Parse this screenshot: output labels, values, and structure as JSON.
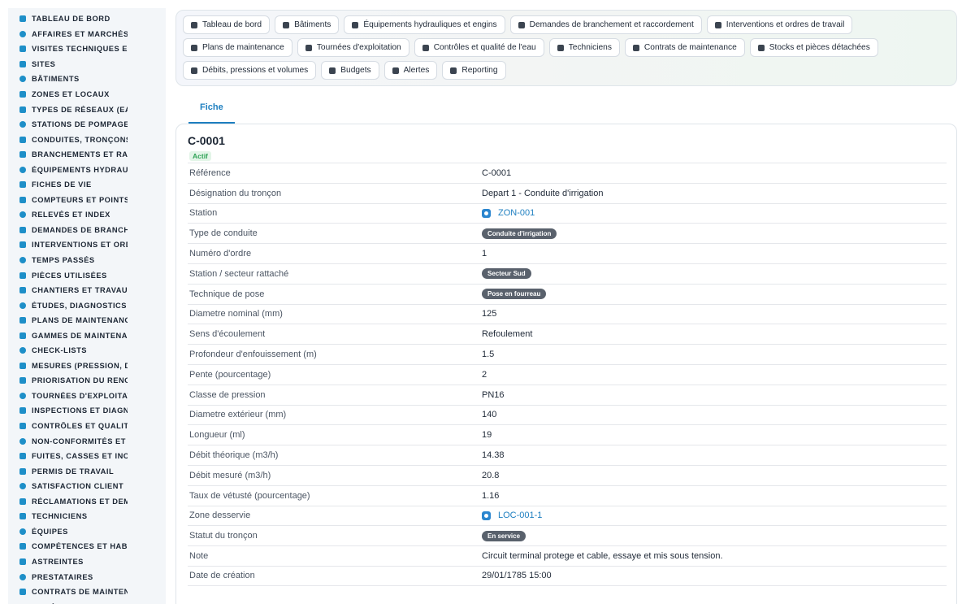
{
  "sidebar": {
    "items": [
      {
        "label": "TABLEAU DE BORD",
        "icon": "dashboard-icon"
      },
      {
        "label": "AFFAIRES ET MARCHÉS",
        "icon": "target-icon"
      },
      {
        "label": "VISITES TECHNIQUES ET",
        "icon": "clipboard-icon"
      },
      {
        "label": "SITES",
        "icon": "map-pin-icon"
      },
      {
        "label": "BÂTIMENTS",
        "icon": "building-icon"
      },
      {
        "label": "ZONES ET LOCAUX",
        "icon": "rooms-icon"
      },
      {
        "label": "TYPES DE RÉSEAUX (EAU",
        "icon": "network-icon"
      },
      {
        "label": "STATIONS DE POMPAGE I",
        "icon": "grid-icon"
      },
      {
        "label": "CONDUITES, TRONÇONS",
        "icon": "pipe-icon"
      },
      {
        "label": "BRANCHEMENTS ET RAC",
        "icon": "connection-icon"
      },
      {
        "label": "ÉQUIPEMENTS HYDRAUL",
        "icon": "gears-icon"
      },
      {
        "label": "FICHES DE VIE",
        "icon": "history-icon"
      },
      {
        "label": "COMPTEURS ET POINTS I",
        "icon": "gauge-icon"
      },
      {
        "label": "RELEVÉS ET INDEX",
        "icon": "chart-icon"
      },
      {
        "label": "DEMANDES DE BRANCHE",
        "icon": "question-icon"
      },
      {
        "label": "INTERVENTIONS ET ORDI",
        "icon": "clipboard-check-icon"
      },
      {
        "label": "TEMPS PASSÉS",
        "icon": "clock-icon"
      },
      {
        "label": "PIÈCES UTILISÉES",
        "icon": "parts-icon"
      },
      {
        "label": "CHANTIERS ET TRAVAUX",
        "icon": "hammer-icon"
      },
      {
        "label": "ÉTUDES, DIAGNOSTICS E",
        "icon": "flask-icon"
      },
      {
        "label": "PLANS DE MAINTENANCE",
        "icon": "calendar-icon"
      },
      {
        "label": "GAMMES DE MAINTENAN",
        "icon": "list-icon"
      },
      {
        "label": "CHECK-LISTS",
        "icon": "checklist-icon"
      },
      {
        "label": "MESURES (PRESSION, DÉ",
        "icon": "thermometer-icon"
      },
      {
        "label": "PRIORISATION DU RENOU",
        "icon": "trend-icon"
      },
      {
        "label": "TOURNÉES D'EXPLOITATI",
        "icon": "route-icon"
      },
      {
        "label": "INSPECTIONS ET DIAGNC",
        "icon": "search-icon"
      },
      {
        "label": "CONTRÔLES ET QUALITÉ",
        "icon": "clipboard-icon"
      },
      {
        "label": "NON-CONFORMITÉS ET A",
        "icon": "alert-circle-icon"
      },
      {
        "label": "FUITES, CASSES ET INCI",
        "icon": "warning-icon"
      },
      {
        "label": "PERMIS DE TRAVAIL",
        "icon": "permit-icon"
      },
      {
        "label": "SATISFACTION CLIENT",
        "icon": "smile-icon"
      },
      {
        "label": "RÉCLAMATIONS ET DEMA",
        "icon": "comment-icon"
      },
      {
        "label": "TECHNICIENS",
        "icon": "helmet-icon"
      },
      {
        "label": "ÉQUIPES",
        "icon": "users-icon"
      },
      {
        "label": "COMPÉTENCES ET HABIL",
        "icon": "badge-icon"
      },
      {
        "label": "ASTREINTES",
        "icon": "phone-icon"
      },
      {
        "label": "PRESTATAIRES",
        "icon": "handshake-icon"
      },
      {
        "label": "CONTRATS DE MAINTENA",
        "icon": "file-icon"
      },
      {
        "label": "MODÈLES DE CONTRATS",
        "icon": "file-icon"
      }
    ]
  },
  "nav": {
    "rows": [
      [
        {
          "label": "Tableau de bord",
          "icon": "dashboard-icon"
        },
        {
          "label": "Bâtiments",
          "icon": "building-icon"
        },
        {
          "label": "Équipements hydrauliques et engins",
          "icon": "gears-icon"
        },
        {
          "label": "Demandes de branchement et raccordement",
          "icon": "question-icon"
        },
        {
          "label": "Interventions et ordres de travail",
          "icon": "clipboard-check-icon"
        }
      ],
      [
        {
          "label": "Plans de maintenance",
          "icon": "calendar-icon"
        },
        {
          "label": "Tournées d'exploitation",
          "icon": "route-icon"
        },
        {
          "label": "Contrôles et qualité de l'eau",
          "icon": "clipboard-icon"
        },
        {
          "label": "Techniciens",
          "icon": "helmet-icon"
        },
        {
          "label": "Contrats de maintenance",
          "icon": "file-icon"
        },
        {
          "label": "Stocks et pièces détachées",
          "icon": "parts-icon"
        }
      ],
      [
        {
          "label": "Débits, pressions et volumes",
          "icon": "bolt-icon"
        },
        {
          "label": "Budgets",
          "icon": "money-icon"
        },
        {
          "label": "Alertes",
          "icon": "bell-icon"
        },
        {
          "label": "Reporting",
          "icon": "pie-chart-icon"
        }
      ]
    ]
  },
  "tabs": [
    {
      "label": "Fiche"
    }
  ],
  "record": {
    "title": "C-0001",
    "status": "Actif",
    "fields": [
      {
        "label": "Référence",
        "value": "C-0001",
        "kind": "text"
      },
      {
        "label": "Désignation du tronçon",
        "value": "Depart 1 - Conduite d'irrigation",
        "kind": "text"
      },
      {
        "label": "Station",
        "value": "ZON-001",
        "kind": "link"
      },
      {
        "label": "Type de conduite",
        "value": "Conduite d'irrigation",
        "kind": "pill"
      },
      {
        "label": "Numéro d'ordre",
        "value": "1",
        "kind": "text"
      },
      {
        "label": "Station / secteur rattaché",
        "value": "Secteur Sud",
        "kind": "pill"
      },
      {
        "label": "Technique de pose",
        "value": "Pose en fourreau",
        "kind": "pill"
      },
      {
        "label": "Diametre nominal (mm)",
        "value": "125",
        "kind": "text"
      },
      {
        "label": "Sens d'écoulement",
        "value": "Refoulement",
        "kind": "text"
      },
      {
        "label": "Profondeur d'enfouissement (m)",
        "value": "1.5",
        "kind": "text"
      },
      {
        "label": "Pente (pourcentage)",
        "value": "2",
        "kind": "text"
      },
      {
        "label": "Classe de pression",
        "value": "PN16",
        "kind": "text"
      },
      {
        "label": "Diametre extérieur (mm)",
        "value": "140",
        "kind": "text"
      },
      {
        "label": "Longueur (ml)",
        "value": "19",
        "kind": "text"
      },
      {
        "label": "Débit théorique (m3/h)",
        "value": "14.38",
        "kind": "text"
      },
      {
        "label": "Débit mesuré (m3/h)",
        "value": "20.8",
        "kind": "text"
      },
      {
        "label": "Taux de vétusté (pourcentage)",
        "value": "1.16",
        "kind": "text"
      },
      {
        "label": "Zone desservie",
        "value": "LOC-001-1",
        "kind": "link"
      },
      {
        "label": "Statut du tronçon",
        "value": "En service",
        "kind": "pill"
      },
      {
        "label": "Note",
        "value": "Circuit terminal protege et cable, essaye et mis sous tension.",
        "kind": "text"
      },
      {
        "label": "Date de création",
        "value": "29/01/1785 15:00",
        "kind": "text"
      }
    ]
  },
  "colors": {
    "accent": "#1e7fc0",
    "sidebar_icon": "#1e8fc8",
    "status_green": "#2fa356",
    "pill_bg": "#59616c"
  }
}
